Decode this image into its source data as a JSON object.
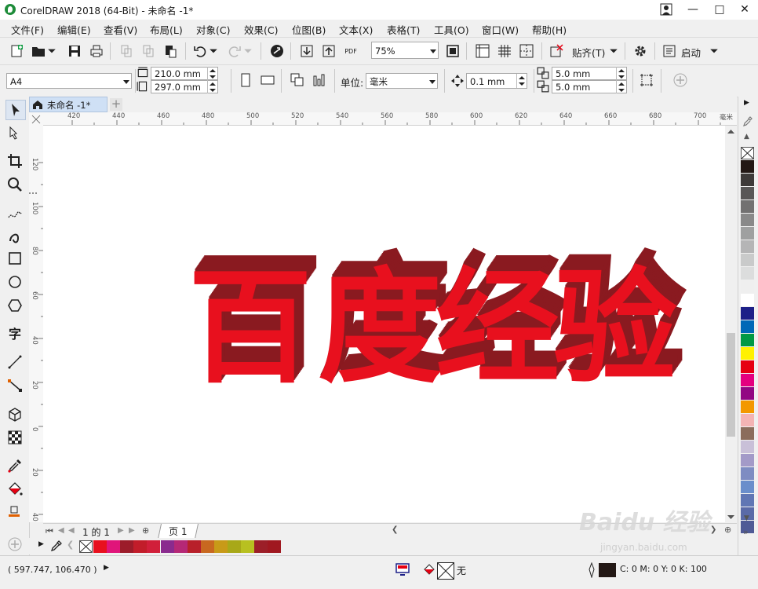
{
  "window": {
    "title": "CorelDRAW 2018 (64-Bit) - 未命名 -1*"
  },
  "menu": [
    "文件(F)",
    "编辑(E)",
    "查看(V)",
    "布局(L)",
    "对象(C)",
    "效果(C)",
    "位图(B)",
    "文本(X)",
    "表格(T)",
    "工具(O)",
    "窗口(W)",
    "帮助(H)"
  ],
  "toolbar": {
    "zoom": "75%",
    "snap_label": "贴齐(T)",
    "launch_label": "启动",
    "pdf_label": "PDF"
  },
  "propertybar": {
    "page_size": "A4",
    "width": "210.0 mm",
    "height": "297.0 mm",
    "unit_label": "单位:",
    "unit": "毫米",
    "nudge": "0.1 mm",
    "dup_x": "5.0 mm",
    "dup_y": "5.0 mm"
  },
  "document_tab": {
    "label": "未命名 -1*"
  },
  "ruler": {
    "h_labels": [
      "420",
      "440",
      "460",
      "480",
      "500",
      "520",
      "540",
      "560",
      "580",
      "600",
      "620",
      "640",
      "660",
      "680",
      "700",
      "毫米"
    ],
    "v_labels": [
      "120",
      "100",
      "80",
      "60",
      "40",
      "20",
      "0",
      "20",
      "40"
    ]
  },
  "canvas": {
    "text": "百度经验",
    "chars": [
      "百",
      "度",
      "经",
      "验"
    ],
    "face_color": "#e8101e",
    "extrude_color": "#8a1a20"
  },
  "page_nav": {
    "counter": "1 的 1",
    "page_tab": "页 1"
  },
  "palette": {
    "bottom": [
      "#e8101e",
      "#e0157a",
      "#9c1c2a",
      "#c21d2a",
      "#d11f3a",
      "#8a2a8e",
      "#b52876",
      "#b8202a",
      "#c86820",
      "#c89a18",
      "#a8a818",
      "#b8c020",
      "#9c1f28",
      "#a01820"
    ],
    "right": [
      "#231815",
      "#3e3a39",
      "#595757",
      "#727171",
      "#898989",
      "#9fa0a0",
      "#b5b5b6",
      "#c9caca",
      "#dcdddd",
      "#efefef",
      "#ffffff",
      "#1d2088",
      "#0068b7",
      "#009944",
      "#fff100",
      "#e60012",
      "#e4007f",
      "#920783",
      "#f39800",
      "#f4b4b4",
      "#8b6d5c",
      "#c9c0d8",
      "#a39ac8",
      "#7e8cc2",
      "#6a8ecb",
      "#6076b4",
      "#5a6aa8",
      "#4f5a96"
    ]
  },
  "status": {
    "coords": "( 597.747, 106.470 )",
    "fill_none": "无",
    "color_info": "C: 0 M: 0 Y: 0 K: 100"
  },
  "watermark": {
    "text": "Baidu 经验",
    "url": "jingyan.baidu.com"
  },
  "colors": {
    "accent_tab": "#cfe0f5",
    "canvas_bg": "#ffffff"
  }
}
